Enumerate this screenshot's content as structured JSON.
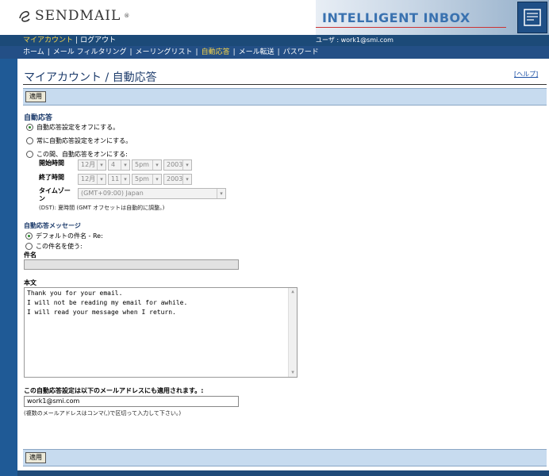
{
  "header": {
    "logo_text": "SENDMAIL",
    "registered_mark": "®",
    "banner_title": "INTELLIGENT INBOX"
  },
  "nav1": {
    "tabs": [
      {
        "label": "マイアカウント",
        "active": true
      },
      {
        "label": "ログアウト",
        "active": false
      }
    ],
    "user_text": "ユーザ : work1@smi.com"
  },
  "nav2": {
    "items": [
      {
        "label": "ホーム",
        "active": false
      },
      {
        "label": "メール フィルタリング",
        "active": false
      },
      {
        "label": "メーリングリスト",
        "active": false
      },
      {
        "label": "自動応答",
        "active": true
      },
      {
        "label": "メール転送",
        "active": false
      },
      {
        "label": "パスワード",
        "active": false
      }
    ],
    "separator": "|"
  },
  "page": {
    "title": "マイアカウント / 自動応答",
    "help_link": "[ヘルプ]",
    "apply_label": "適用"
  },
  "autoresponse": {
    "heading": "自動応答",
    "options": [
      {
        "label": "自動応答設定をオフにする。",
        "checked": true
      },
      {
        "label": "常に自動応答設定をオンにする。",
        "checked": false
      },
      {
        "label": "この間、自動応答をオンにする:",
        "checked": false
      }
    ],
    "start_label": "開始時間",
    "end_label": "終了時間",
    "start": {
      "month": "12月",
      "day": "4",
      "time": "5pm",
      "year": "2003"
    },
    "end": {
      "month": "12月",
      "day": "11",
      "time": "5pm",
      "year": "2003"
    },
    "timezone_label": "タイムゾーン",
    "timezone_value": "(GMT+09:00) Japan",
    "dst_note": "(DST): 夏時間 (GMT オフセットは自動的に調整。)"
  },
  "message": {
    "heading": "自動応答メッセージ",
    "options": [
      {
        "label": "デフォルトの件名 - Re:",
        "checked": true
      },
      {
        "label": "この件名を使う:",
        "checked": false
      }
    ],
    "subject_label": "件名",
    "subject_value": "",
    "body_label": "本文",
    "body_lines": [
      "Thank you for your email.",
      "I will not be reading my email for awhile.",
      "I will read your message when I return."
    ]
  },
  "addresses": {
    "heading": "この自動応答設定は以下のメールアドレスにも適用されます。:",
    "value": "work1@smi.com",
    "note": "(複数のメールアドレスはコンマ(,)で区切って入力して下さい。)"
  },
  "colors": {
    "nav_bg": "#1c4a78",
    "active_tab": "#f6d44a",
    "apply_bar": "#c7dbef",
    "heading": "#1c3b6b"
  }
}
